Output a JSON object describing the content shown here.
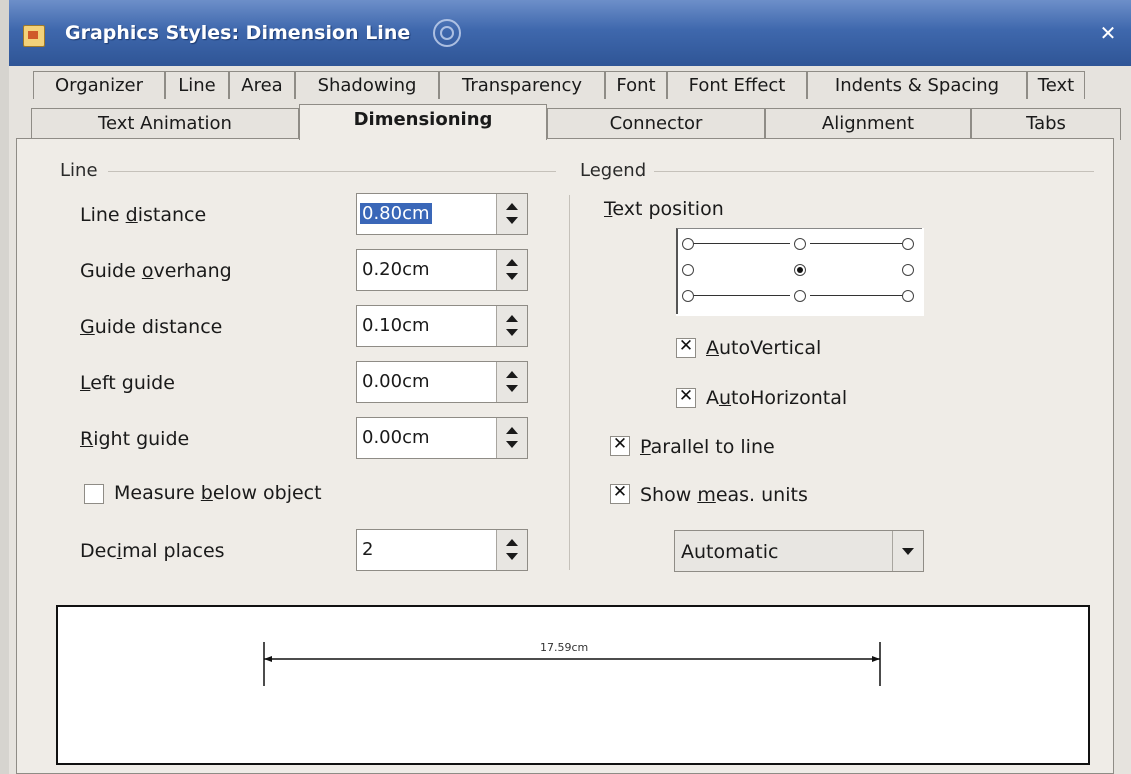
{
  "window": {
    "title": "Graphics Styles: Dimension Line"
  },
  "tabs_row1": [
    "Organizer",
    "Line",
    "Area",
    "Shadowing",
    "Transparency",
    "Font",
    "Font Effect",
    "Indents & Spacing",
    "Text"
  ],
  "tabs_row2": [
    "Text Animation",
    "Dimensioning",
    "Connector",
    "Alignment",
    "Tabs"
  ],
  "active_tab": "Dimensioning",
  "line_section": {
    "title": "Line",
    "line_distance": {
      "label": "Line distance",
      "value": "0.80cm"
    },
    "guide_overhang": {
      "label": "Guide overhang",
      "value": "0.20cm"
    },
    "guide_distance": {
      "label": "Guide distance",
      "value": "0.10cm"
    },
    "left_guide": {
      "label": "Left guide",
      "value": "0.00cm"
    },
    "right_guide": {
      "label": "Right guide",
      "value": "0.00cm"
    },
    "measure_below": {
      "label": "Measure below object",
      "checked": false
    },
    "decimal_places": {
      "label": "Decimal places",
      "value": "2"
    }
  },
  "legend_section": {
    "title": "Legend",
    "text_position_label": "Text position",
    "auto_vertical": {
      "label": "AutoVertical",
      "checked": true
    },
    "auto_horizontal": {
      "label": "AutoHorizontal",
      "checked": true
    },
    "parallel_to_line": {
      "label": "Parallel to line",
      "checked": true
    },
    "show_meas_units": {
      "label": "Show meas. units",
      "checked": true
    },
    "units_dropdown": {
      "value": "Automatic"
    }
  },
  "preview": {
    "measurement": "17.59cm"
  }
}
